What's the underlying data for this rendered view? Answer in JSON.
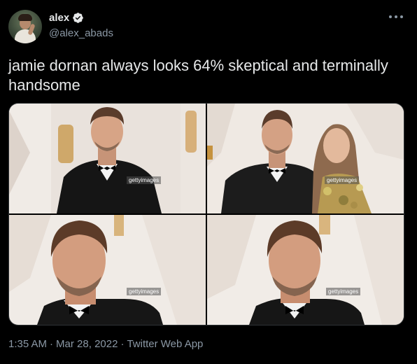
{
  "author": {
    "display_name": "alex",
    "handle": "@alex_abads",
    "verified": true
  },
  "tweet": {
    "text": "jamie dornan always looks 64% skeptical and terminally handsome"
  },
  "media": {
    "photos": [
      {
        "watermark": "gettyimages"
      },
      {
        "watermark": "gettyimages"
      },
      {
        "watermark": "gettyimages"
      },
      {
        "watermark": "gettyimages"
      }
    ]
  },
  "meta": {
    "time": "1:35 AM",
    "separator": "·",
    "date": "Mar 28, 2022",
    "client": "Twitter Web App"
  },
  "colors": {
    "background": "#000000",
    "text_primary": "#e7e9ea",
    "text_secondary": "#8b98a5",
    "verified_badge": "#e7e9ea"
  },
  "icons": {
    "verified": "verified-badge-icon",
    "more": "more-options-icon"
  }
}
